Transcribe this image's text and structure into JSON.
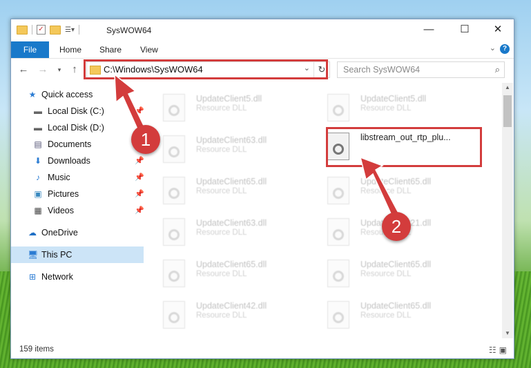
{
  "window": {
    "title": "SysWOW64",
    "minimize": "—",
    "maximize": "☐",
    "close": "✕"
  },
  "ribbon": {
    "file": "File",
    "tabs": [
      "Home",
      "Share",
      "View"
    ],
    "help": "?"
  },
  "nav": {
    "address": "C:\\Windows\\SysWOW64",
    "search_placeholder": "Search SysWOW64"
  },
  "sidebar": {
    "items": [
      {
        "label": "Quick access",
        "icon": "star-icon",
        "pinned": false
      },
      {
        "label": "Local Disk (C:)",
        "icon": "drive-icon",
        "pinned": true
      },
      {
        "label": "Local Disk (D:)",
        "icon": "drive-icon",
        "pinned": false
      },
      {
        "label": "Documents",
        "icon": "documents-icon",
        "pinned": true
      },
      {
        "label": "Downloads",
        "icon": "download-icon",
        "pinned": true
      },
      {
        "label": "Music",
        "icon": "music-icon",
        "pinned": true
      },
      {
        "label": "Pictures",
        "icon": "pictures-icon",
        "pinned": true
      },
      {
        "label": "Videos",
        "icon": "videos-icon",
        "pinned": true
      },
      {
        "label": "OneDrive",
        "icon": "cloud-icon",
        "pinned": false
      },
      {
        "label": "This PC",
        "icon": "computer-icon",
        "pinned": false,
        "selected": true
      },
      {
        "label": "Network",
        "icon": "network-icon",
        "pinned": false
      }
    ]
  },
  "files": [
    {
      "name": "UpdateClient5.dll",
      "type": "Resource DLL"
    },
    {
      "name": "UpdateClient5.dll",
      "type": "Resource DLL"
    },
    {
      "name": "UpdateClient63.dll",
      "type": "Resource DLL"
    },
    {
      "name": "libstream_out_rtp_plu...",
      "type": ""
    },
    {
      "name": "UpdateClient65.dll",
      "type": "Resource DLL"
    },
    {
      "name": "UpdateClient65.dll",
      "type": "Resource DLL"
    },
    {
      "name": "UpdateClient63.dll",
      "type": "Resource DLL"
    },
    {
      "name": "UpdateClient21.dll",
      "type": "Resource DLL"
    },
    {
      "name": "UpdateClient65.dll",
      "type": "Resource DLL"
    },
    {
      "name": "UpdateClient65.dll",
      "type": "Resource DLL"
    },
    {
      "name": "UpdateClient42.dll",
      "type": "Resource DLL"
    },
    {
      "name": "UpdateClient65.dll",
      "type": "Resource DLL"
    }
  ],
  "status": {
    "items": "159 items"
  },
  "annotations": {
    "badge1": "1",
    "badge2": "2",
    "color": "#d33c3c"
  }
}
